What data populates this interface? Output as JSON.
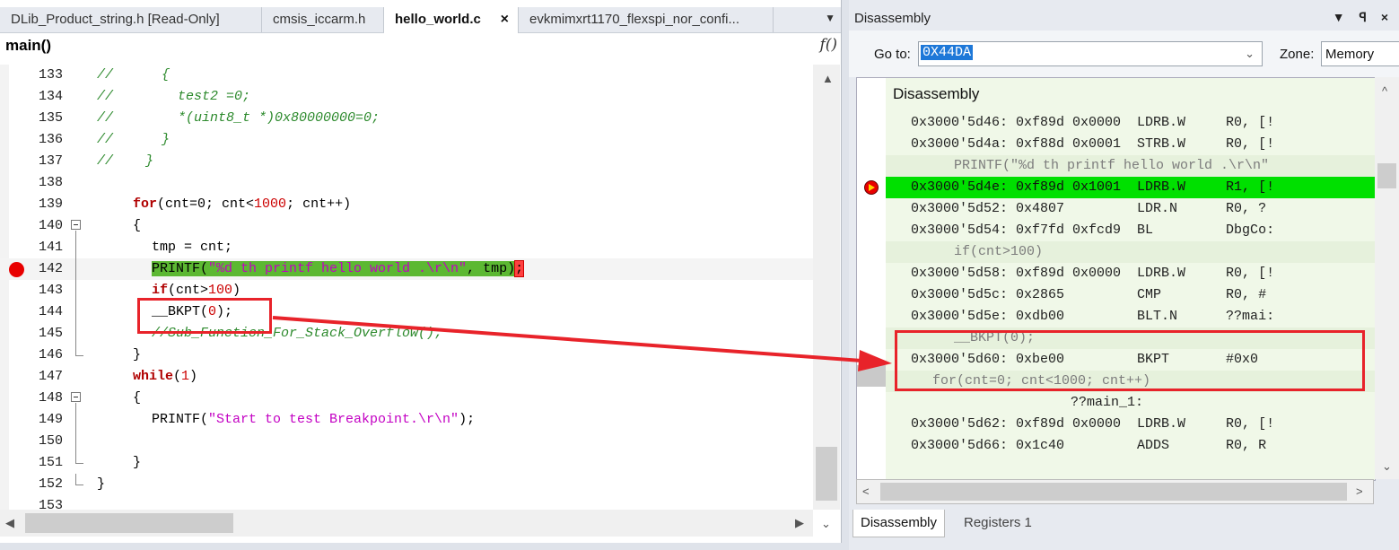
{
  "editor": {
    "tabs": [
      {
        "label": "DLib_Product_string.h [Read-Only]"
      },
      {
        "label": "cmsis_iccarm.h"
      },
      {
        "label": "hello_world.c"
      },
      {
        "label": "evkmimxrt1170_flexspi_nor_confi..."
      }
    ],
    "tab_close": "×",
    "tab_overflow": "▼",
    "function_name": "main()",
    "function_icon": "f()",
    "lines": [
      {
        "n": "133"
      },
      {
        "n": "134"
      },
      {
        "n": "135"
      },
      {
        "n": "136"
      },
      {
        "n": "137"
      },
      {
        "n": "138"
      },
      {
        "n": "139"
      },
      {
        "n": "140"
      },
      {
        "n": "141"
      },
      {
        "n": "142"
      },
      {
        "n": "143"
      },
      {
        "n": "144"
      },
      {
        "n": "145"
      },
      {
        "n": "146"
      },
      {
        "n": "147"
      },
      {
        "n": "148"
      },
      {
        "n": "149"
      },
      {
        "n": "150"
      },
      {
        "n": "151"
      },
      {
        "n": "152"
      },
      {
        "n": "153"
      }
    ],
    "code": {
      "l133": "//      {",
      "l134_a": "//        ",
      "l134_b": "test2 =0;",
      "l135": "//        *(uint8_t *)0x80000000=0;",
      "l136": "//      }",
      "l137": "//    }",
      "for_kw": "for",
      "for_a": "(cnt=0; cnt<",
      "for_num": "1000",
      "for_b": "; cnt++)",
      "brace_open": "{",
      "l141": "tmp = cnt;",
      "printf_a": "PRINTF(",
      "printf_str": "\"%d th printf hello world .\\r\\n\"",
      "printf_b": ", tmp)",
      "printf_c": ";",
      "if_kw": "if",
      "if_a": "(cnt>",
      "if_num": "100",
      "if_b": ")",
      "bkpt_a": "__BKPT(",
      "bkpt_num": "0",
      "bkpt_b": ");",
      "l145": "//Sub_Function_For_Stack_Overflow();",
      "brace_close": "}",
      "while_kw": "while",
      "while_a": "(",
      "while_num": "1",
      "while_b": ")",
      "printf2_a": "PRINTF(",
      "printf2_str": "\"Start to test Breakpoint.\\r\\n\"",
      "printf2_b": ");"
    }
  },
  "disassembly": {
    "title": "Disassembly",
    "title_controls": "▼ ꟼ ×",
    "goto_label": "Go to:",
    "goto_value": "0X44DA",
    "zone_label": "Zone:",
    "zone_value": "Memory",
    "header": "Disassembly",
    "rows": [
      {
        "text": "0x3000'5d46: 0xf89d 0x0000  LDRB.W     R0, [!"
      },
      {
        "text": "0x3000'5d4a: 0xf88d 0x0001  STRB.W     R0, [!"
      },
      {
        "text": "PRINTF(\"%d th printf hello world .\\r\\n\""
      },
      {
        "text": "0x3000'5d4e: 0xf89d 0x1001  LDRB.W     R1, [!"
      },
      {
        "text": "0x3000'5d52: 0x4807         LDR.N      R0, ?"
      },
      {
        "text": "0x3000'5d54: 0xf7fd 0xfcd9  BL         DbgCo:"
      },
      {
        "text": "if(cnt>100)"
      },
      {
        "text": "0x3000'5d58: 0xf89d 0x0000  LDRB.W     R0, [!"
      },
      {
        "text": "0x3000'5d5c: 0x2865         CMP        R0, #"
      },
      {
        "text": "0x3000'5d5e: 0xdb00         BLT.N      ??mai:"
      },
      {
        "text": "__BKPT(0);"
      },
      {
        "text": "0x3000'5d60: 0xbe00         BKPT       #0x0"
      },
      {
        "text": "for(cnt=0; cnt<1000; cnt++)"
      },
      {
        "text": "??main_1:"
      },
      {
        "text": "0x3000'5d62: 0xf89d 0x0000  LDRB.W     R0, [!"
      },
      {
        "text": "0x3000'5d66: 0x1c40         ADDS       R0, R"
      }
    ],
    "bottom_tabs": [
      {
        "label": "Disassembly"
      },
      {
        "label": "Registers 1"
      }
    ]
  }
}
